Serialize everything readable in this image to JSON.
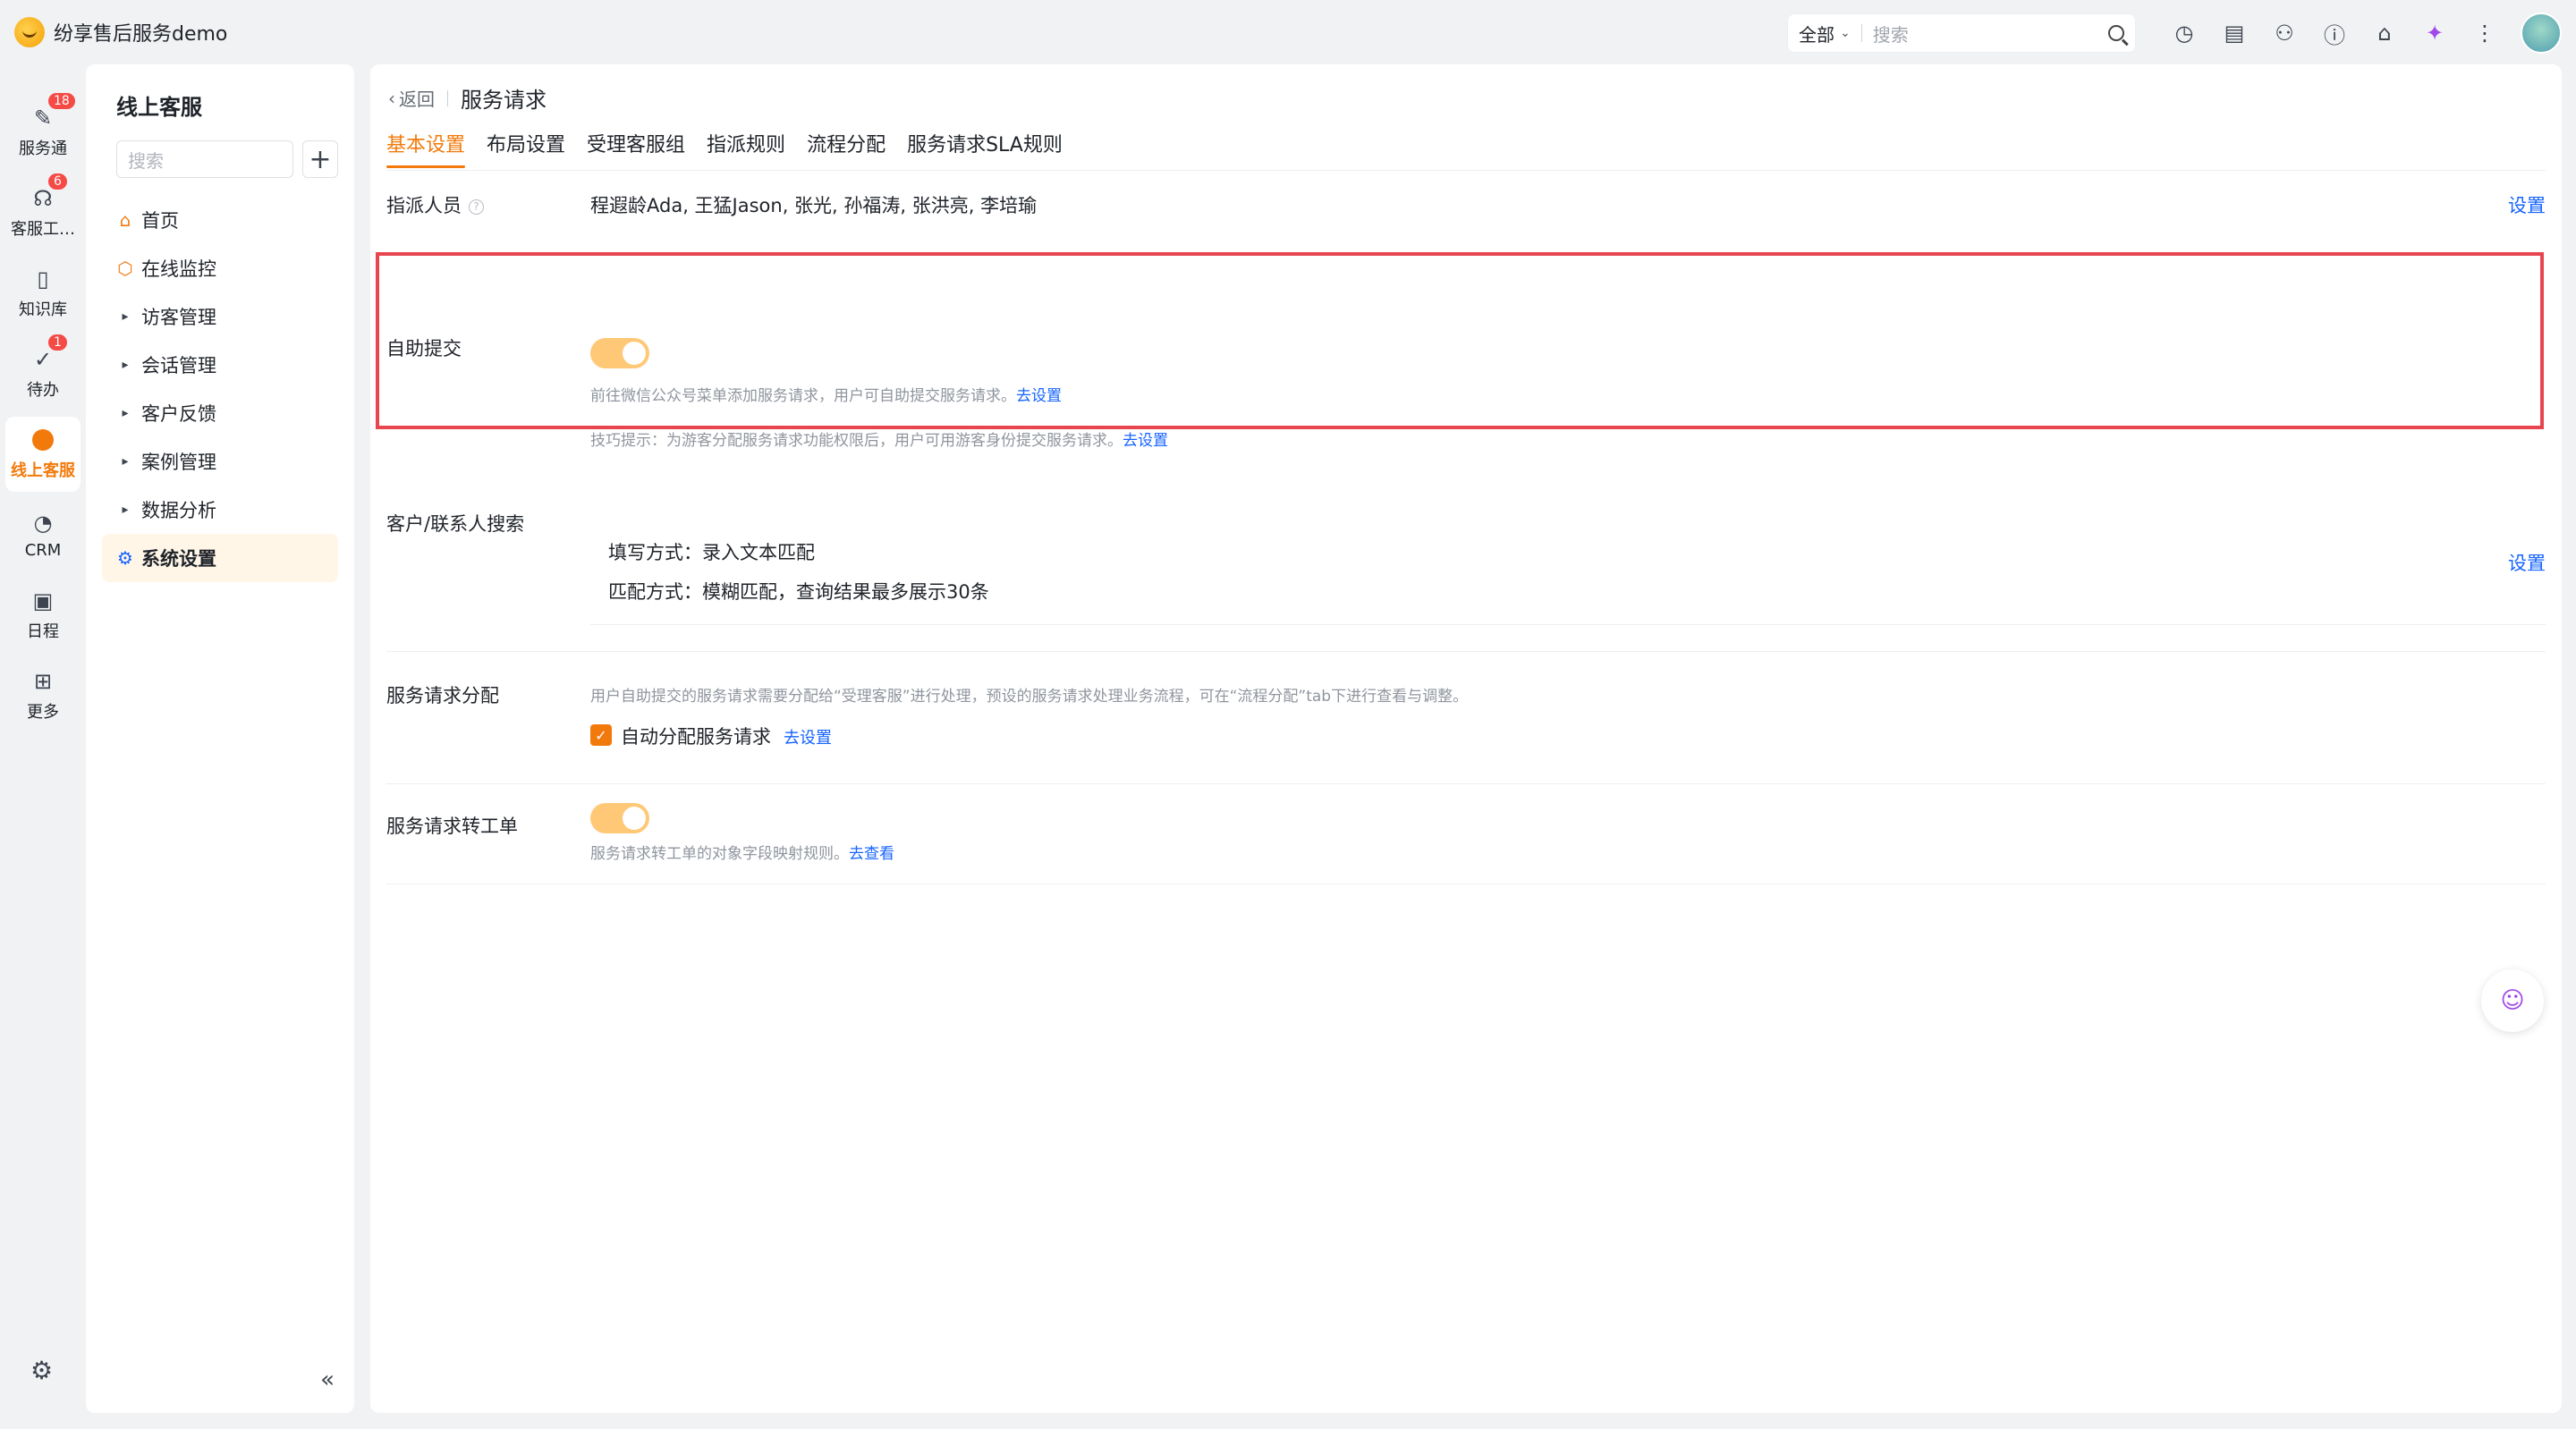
{
  "app": {
    "title": "纷享售后服务demo"
  },
  "topbar": {
    "search_scope": "全部",
    "search_placeholder": "搜索",
    "icons": [
      "clock-icon",
      "inbox-icon",
      "contacts-icon",
      "help-icon",
      "bag-icon",
      "mic-icon",
      "more-icon"
    ]
  },
  "rail": {
    "items": [
      {
        "label": "服务通",
        "badge": "18",
        "icon": "service-icon"
      },
      {
        "label": "客服工…",
        "badge": "6",
        "icon": "headset-icon"
      },
      {
        "label": "知识库",
        "badge": "",
        "icon": "book-icon"
      },
      {
        "label": "待办",
        "badge": "1",
        "icon": "todo-icon"
      },
      {
        "label": "线上客服",
        "badge": "",
        "icon": "online-service-icon",
        "active": true
      },
      {
        "label": "CRM",
        "badge": "",
        "icon": "crm-icon"
      },
      {
        "label": "日程",
        "badge": "",
        "icon": "calendar-icon"
      },
      {
        "label": "更多",
        "badge": "",
        "icon": "grid-icon"
      }
    ]
  },
  "nav": {
    "title": "线上客服",
    "search_placeholder": "搜索",
    "items": [
      {
        "label": "首页",
        "icon": "home-icon"
      },
      {
        "label": "在线监控",
        "icon": "monitor-icon"
      },
      {
        "label": "访客管理",
        "icon": "caret-right-icon"
      },
      {
        "label": "会话管理",
        "icon": "caret-right-icon"
      },
      {
        "label": "客户反馈",
        "icon": "caret-right-icon"
      },
      {
        "label": "案例管理",
        "icon": "caret-right-icon"
      },
      {
        "label": "数据分析",
        "icon": "caret-right-icon"
      },
      {
        "label": "系统设置",
        "icon": "settings-icon",
        "active": true
      }
    ]
  },
  "main": {
    "back_label": "返回",
    "page_title": "服务请求",
    "tabs": [
      "基本设置",
      "布局设置",
      "受理客服组",
      "指派规则",
      "流程分配",
      "服务请求SLA规则"
    ],
    "assignee": {
      "label": "指派人员",
      "value": "程遐龄Ada, 王猛Jason, 张光, 孙福涛, 张洪亮, 李培瑜",
      "action": "设置"
    },
    "self_submit": {
      "label": "自助提交",
      "enabled": true,
      "hint1_text": "前往微信公众号菜单添加服务请求，用户可自助提交服务请求。",
      "hint1_link": "去设置",
      "hint2_text": "技巧提示：为游客分配服务请求功能权限后，用户可用游客身份提交服务请求。",
      "hint2_link": "去设置"
    },
    "customer_search": {
      "label": "客户/联系人搜索",
      "line1": "填写方式：录入文本匹配",
      "line2": "匹配方式：模糊匹配，查询结果最多展示30条",
      "action": "设置"
    },
    "distribution": {
      "label": "服务请求分配",
      "hint": "用户自助提交的服务请求需要分配给“受理客服”进行处理，预设的服务请求处理业务流程，可在“流程分配”tab下进行查看与调整。",
      "checkbox_label": "自动分配服务请求",
      "checked": true,
      "link": "去设置"
    },
    "to_ticket": {
      "label": "服务请求转工单",
      "enabled": true,
      "hint": "服务请求转工单的对象字段映射规则。",
      "link": "去查看"
    }
  },
  "colors": {
    "accent": "#f27a0c",
    "link": "#1664ff",
    "highlight": "#e8464f",
    "toggle_on": "#ffc876"
  }
}
